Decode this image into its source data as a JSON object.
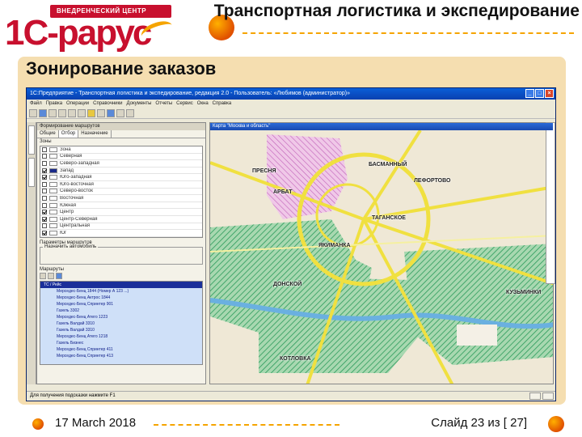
{
  "header": {
    "logo_banner": "ВНЕДРЕНЧЕСКИЙ ЦЕНТР",
    "logo_text": "1С-рарус",
    "title": "Транспортная логистика и экспедирование"
  },
  "section": {
    "title": "Зонирование заказов"
  },
  "app": {
    "window_title": "1С:Предприятие - Транспортная логистика и экспедирование, редакция 2.0 - Пользователь: «Любимов (администратор)»",
    "menu": [
      "Файл",
      "Правка",
      "Операции",
      "Справочники",
      "Документы",
      "Отчеты",
      "Сервис",
      "Окна",
      "Справка"
    ],
    "left_panel": {
      "title": "Формирование маршрутов",
      "tabs": [
        "Общие",
        "Отбор",
        "Назначение"
      ],
      "zones_label": "Зоны",
      "zones": [
        {
          "name": "Зона",
          "checked": false,
          "color": "#ffffff"
        },
        {
          "name": "Северная",
          "checked": false,
          "color": "#ffffff"
        },
        {
          "name": "Северо-западная",
          "checked": false,
          "color": "#ffffff"
        },
        {
          "name": "Запад",
          "checked": true,
          "color": "#1a2a8a"
        },
        {
          "name": "Юго-западная",
          "checked": true,
          "color": "#ffffff"
        },
        {
          "name": "Юго-восточная",
          "checked": false,
          "color": "#ffffff"
        },
        {
          "name": "Северо-восток",
          "checked": false,
          "color": "#ffffff"
        },
        {
          "name": "Восточная",
          "checked": false,
          "color": "#ffffff"
        },
        {
          "name": "Южная",
          "checked": false,
          "color": "#ffffff"
        },
        {
          "name": "Центр",
          "checked": true,
          "color": "#ffffff"
        },
        {
          "name": "Центр-Северная",
          "checked": true,
          "color": "#ffffff"
        },
        {
          "name": "Центральная",
          "checked": false,
          "color": "#ffffff"
        },
        {
          "name": "Юг",
          "checked": true,
          "color": "#ffffff"
        },
        {
          "name": "Север",
          "checked": false,
          "color": "#ffffff"
        }
      ],
      "params_label": "Параметры маршрутов",
      "params_sub": "Назначить автомобиль",
      "routes_label": "Маршруты",
      "routes": [
        "ТС / Рейс",
        "Мерседес-Бенц 1844 (Номер А 123 ...)",
        "Мерседес-Бенц Актрос 1844",
        "Мерседес-Бенц Спринтер 901",
        "Газель 3302",
        "Мерседес-Бенц Атего 1223",
        "Газель Валдай 3310",
        "Газель Валдай 3310",
        "Мерседес-Бенц Атего 1218",
        "Газель Бизнес",
        "Мерседес-Бенц Спринтер 411",
        "Мерседес-Бенц Спринтер 413"
      ]
    },
    "map": {
      "title": "Карта \"Москва и область\"",
      "districts": [
        "ПРЕСНЯ",
        "БАСМАННЫЙ",
        "ЛЕФОРТОВО",
        "АРБАТ",
        "ТАГАНСКОЕ",
        "ЯКИМАНКА",
        "ДОНСКОЙ",
        "КУЗЬМИНКИ",
        "КОТЛОВКА"
      ]
    },
    "status_text": "Для получения подсказки нажмите F1"
  },
  "footer": {
    "date": "17 March 2018",
    "slide_number": "Слайд 23 из [ 27]"
  },
  "colors": {
    "brand_red": "#c8102e",
    "accent_orange": "#f5a400",
    "panel_beige": "#f5deb0"
  }
}
